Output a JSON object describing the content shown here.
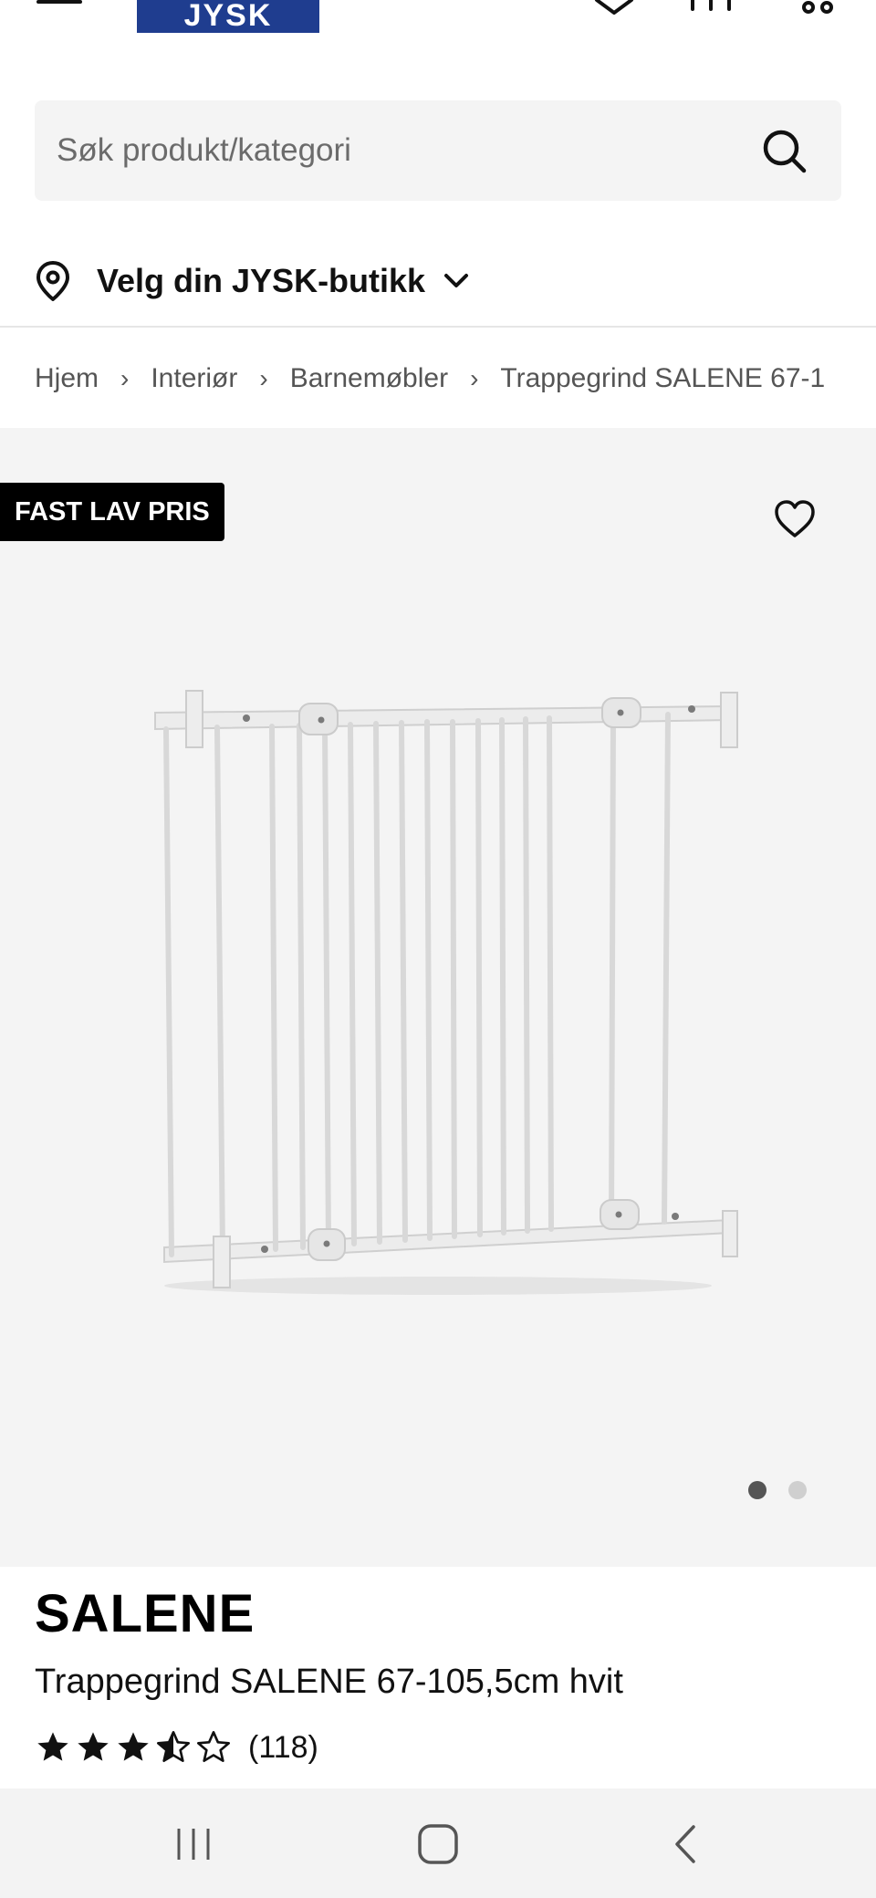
{
  "header": {
    "logo_text": "JYSK",
    "icons": [
      "menu-icon",
      "heart-icon",
      "cart-icon",
      "user-icon"
    ]
  },
  "search": {
    "placeholder": "Søk produkt/kategori",
    "icon": "search-icon"
  },
  "store": {
    "label": "Velg din JYSK-butikk",
    "icon": "location-pin-icon"
  },
  "breadcrumb": {
    "items": [
      "Hjem",
      "Interiør",
      "Barnemøbler",
      "Trappegrind SALENE 67-1"
    ]
  },
  "gallery": {
    "badge": "FAST LAV PRIS",
    "image_count": 2,
    "active_index": 1
  },
  "product": {
    "brand": "SALENE",
    "name": "Trappegrind SALENE 67-105,5cm hvit",
    "rating": 3.5,
    "rating_max": 5,
    "review_count": "(118)"
  },
  "colors": {
    "brand_blue": "#1f3d8f",
    "badge_bg": "#000000",
    "gallery_bg": "#f4f4f4"
  }
}
